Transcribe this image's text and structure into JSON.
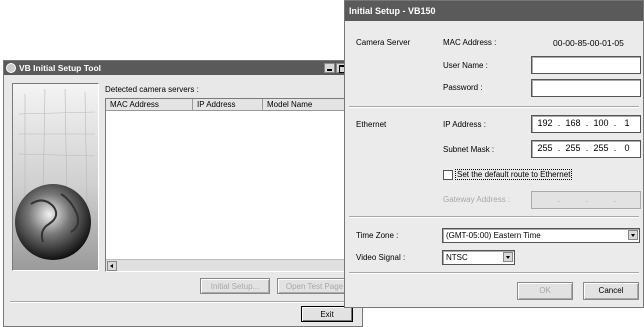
{
  "bg_window": {
    "title": "VB Initial Setup Tool",
    "detected_label": "Detected camera servers :",
    "columns": [
      "MAC Address",
      "IP Address",
      "Model Name"
    ],
    "initial_setup_button": "Initial Setup...",
    "open_test_page_button": "Open Test Page",
    "exit_button": "Exit"
  },
  "dialog": {
    "title": "Initial Setup - VB150",
    "camera_server": {
      "section_label": "Camera Server",
      "mac_label": "MAC Address :",
      "mac_value": "00-00-85-00-01-05",
      "user_label": "User Name :",
      "user_value": "",
      "password_label": "Password :",
      "password_value": ""
    },
    "ethernet": {
      "section_label": "Ethernet",
      "ip_label": "IP Address :",
      "ip": [
        "192",
        "168",
        "100",
        "1"
      ],
      "mask_label": "Subnet Mask :",
      "mask": [
        "255",
        "255",
        "255",
        "0"
      ],
      "default_route_label": "Set the default route to Ethernet",
      "default_route_checked": false,
      "gateway_label": "Gateway Address :"
    },
    "time_zone_label": "Time Zone :",
    "time_zone_value": "(GMT-05:00) Eastern Time",
    "video_signal_label": "Video Signal :",
    "video_signal_value": "NTSC",
    "ok_button": "OK",
    "cancel_button": "Cancel"
  }
}
